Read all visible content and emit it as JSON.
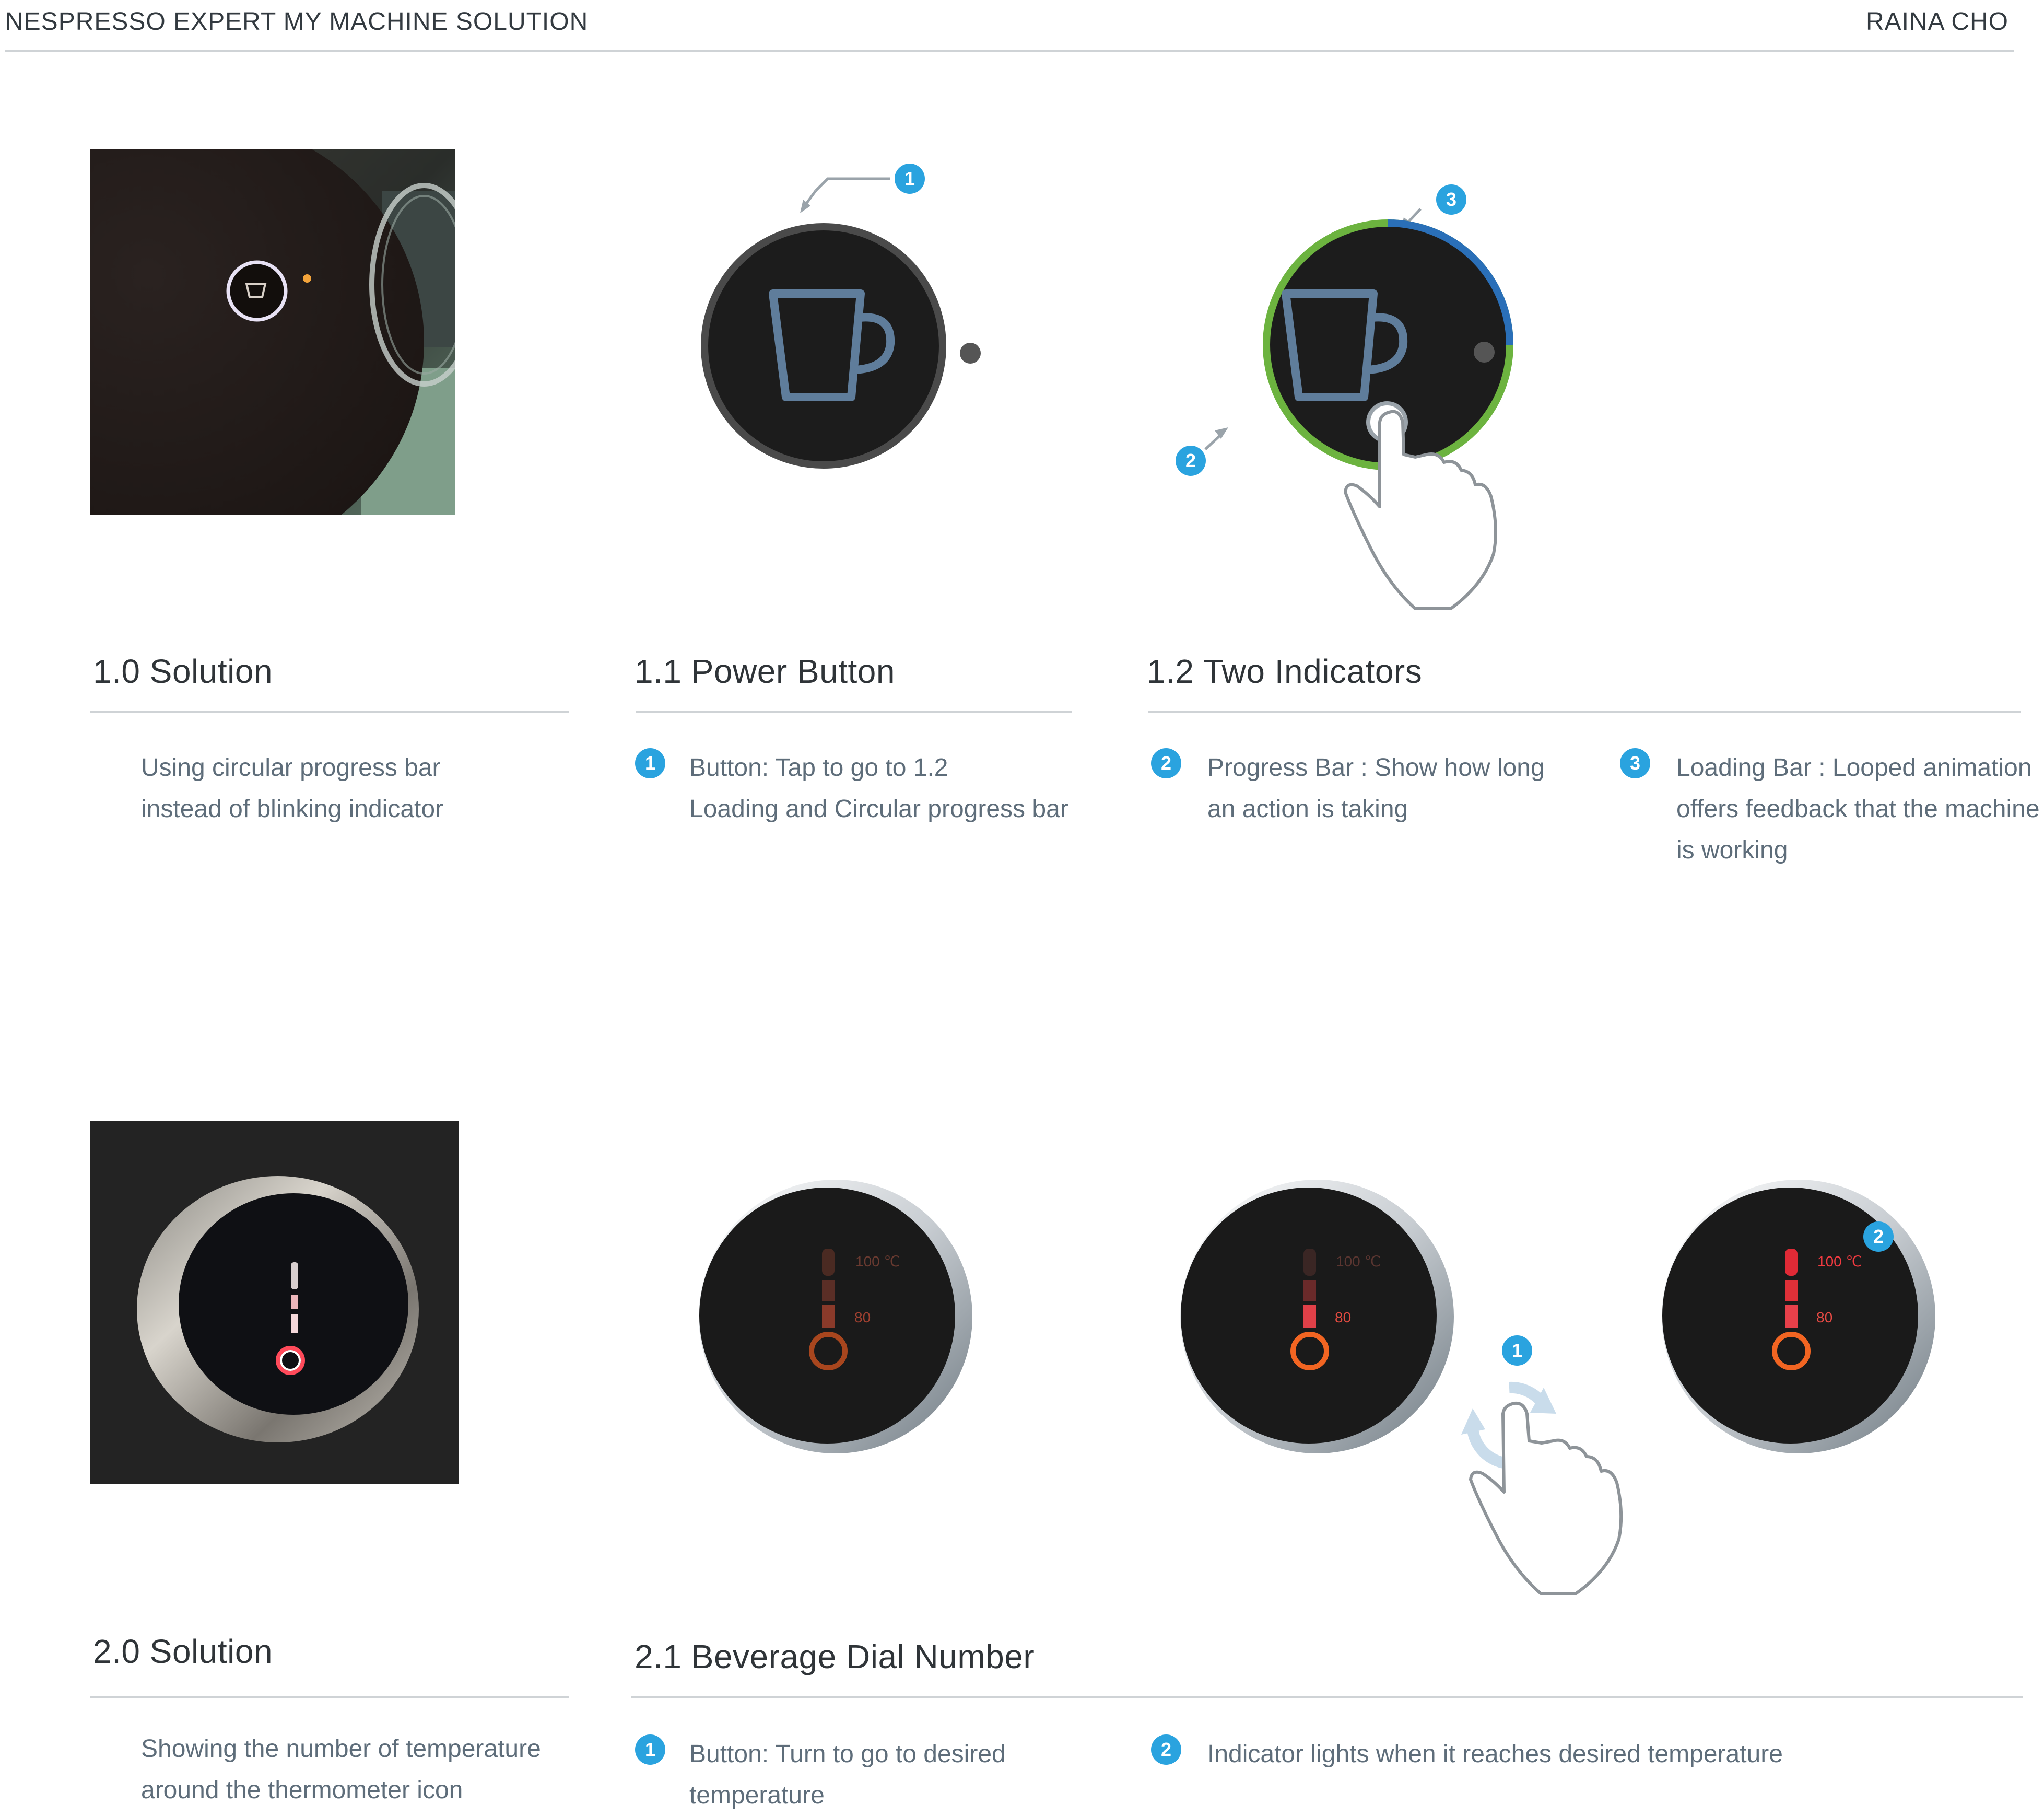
{
  "header": {
    "title": "NESPRESSO EXPERT MY MACHINE SOLUTION",
    "author": "RAINA CHO"
  },
  "row1": {
    "solution": {
      "title": "1.0 Solution",
      "lines": [
        "Using circular progress bar",
        "instead of blinking indicator"
      ]
    },
    "power": {
      "title": "1.1 Power Button",
      "badge": "1",
      "lines": [
        "Button: Tap to go to 1.2",
        "Loading and Circular progress bar"
      ],
      "figure_badge": "1"
    },
    "indicators": {
      "title": "1.2 Two Indicators",
      "item2": {
        "badge": "2",
        "lines": [
          "Progress Bar : Show how long",
          "an action is taking"
        ]
      },
      "item3": {
        "badge": "3",
        "lines": [
          "Loading Bar : Looped animation",
          "offers feedback that the machine",
          "is working"
        ]
      },
      "figure_badges": [
        "3",
        "2"
      ]
    }
  },
  "row2": {
    "solution": {
      "title": "2.0 Solution",
      "lines": [
        "Showing the number of temperature",
        "around the thermometer icon"
      ]
    },
    "dial": {
      "title": "2.1 Beverage Dial Number",
      "item1": {
        "badge": "1",
        "lines": [
          "Button: Turn to go to desired",
          "temperature"
        ]
      },
      "item2": {
        "badge": "2",
        "lines": [
          "Indicator lights when it reaches desired temperature"
        ]
      }
    },
    "dials": [
      {
        "top_label": "100 ℃",
        "bottom_label": "80"
      },
      {
        "top_label": "100 ℃",
        "bottom_label": "80"
      },
      {
        "top_label": "100 ℃",
        "bottom_label": "80"
      }
    ],
    "figure_badges": [
      "1",
      "2"
    ]
  },
  "colors": {
    "accent_blue": "#2aa3df",
    "progress_green": "#8dbb3e",
    "loading_blue": "#2a6fb8",
    "cup_stroke": "#5f7d9b",
    "thermo_orange": "#f26522",
    "thermo_red": "#e03030"
  }
}
